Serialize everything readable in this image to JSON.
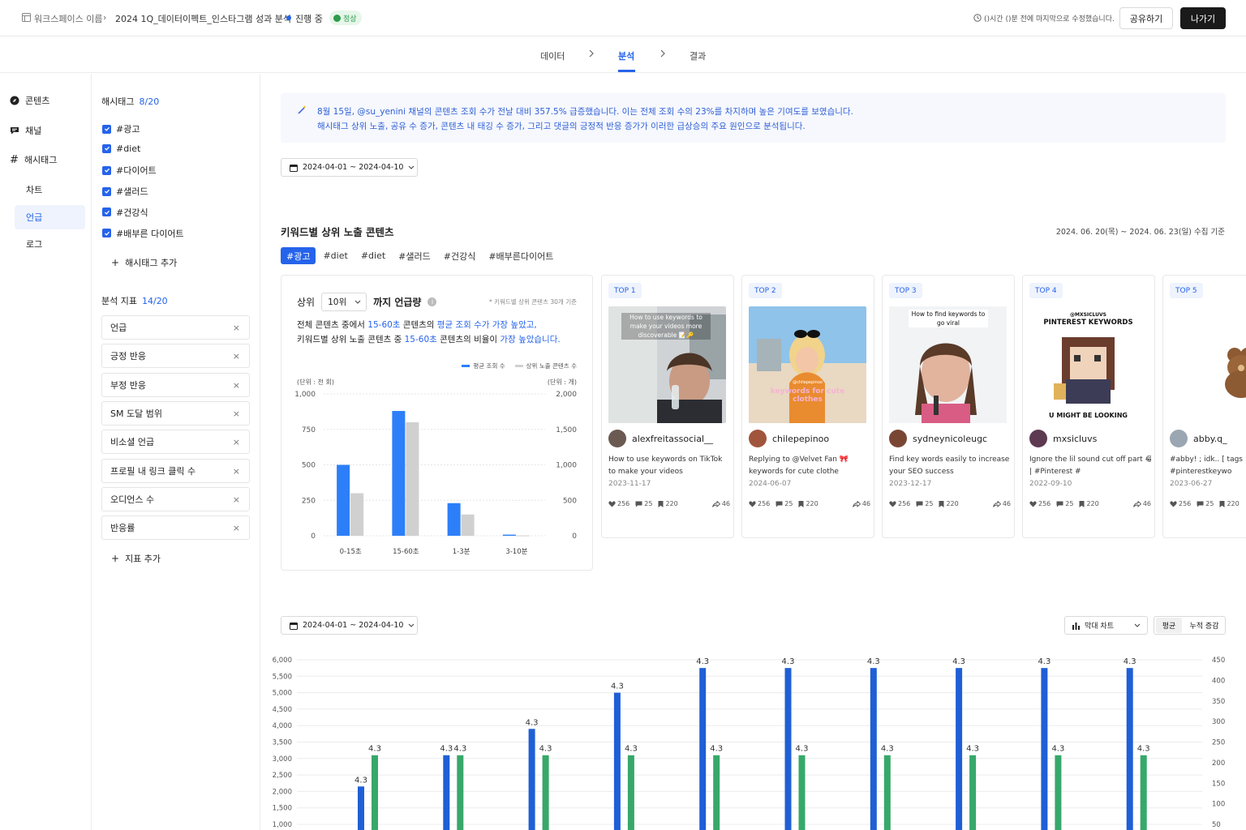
{
  "topbar": {
    "workspace": "워크스페이스 이름",
    "project": "2024 1Q_데이터이펙트_인스타그램 성과 분석",
    "status": "진행 중",
    "health": "정상",
    "modified": "()시간 ()분 전에 마지막으로 수정했습니다.",
    "share_label": "공유하기",
    "exit_label": "나가기"
  },
  "steps": [
    "데이터",
    "분석",
    "결과"
  ],
  "leftnav": {
    "items": [
      "콘텐츠",
      "채널",
      "해시태그"
    ],
    "subitems": [
      "차트",
      "언급",
      "로그"
    ]
  },
  "filter": {
    "hashtag_title": "해시태그",
    "hashtag_count": "8/20",
    "hashtags": [
      "#광고",
      "#diet",
      "#다이어트",
      "#샐러드",
      "#건강식",
      "#배부른 다이어트"
    ],
    "add_hashtag": "해시태그 추가",
    "metric_title": "분석 지표",
    "metric_count": "14/20",
    "metrics": [
      "언급",
      "긍정 반응",
      "부정 반응",
      "SM 도달 범위",
      "비소셜 언급",
      "프로필 내 링크 클릭 수",
      "오디언스 수",
      "반응률"
    ],
    "add_metric": "지표 추가"
  },
  "banner": {
    "line1": "8월 15일, @su_yenini 채널의 콘텐츠 조회 수가 전날 대비 357.5% 급증했습니다. 이는 전체 조회 수의 23%를 차지하며 높은 기여도를 보였습니다.",
    "line2": "해시태그 상위 노출, 공유 수 증가, 콘텐츠 내 태깅 수 증가, 그리고 댓글의 긍정적 반응 증가가 이러한 급상승의 주요 원인으로 분석됩니다."
  },
  "date_range": "2024-04-01 ~ 2024-04-10",
  "section": {
    "title": "키워드별 상위 노출 콘텐츠",
    "period": "2024. 06. 20(목) ~ 2024. 06. 23(일) 수집 기준",
    "keywords": [
      "#광고",
      "#diet",
      "#diet",
      "#샐러드",
      "#건강식",
      "#배부른다이어트"
    ]
  },
  "chartcard": {
    "prefix": "상위",
    "rank": "10위",
    "suffix": "까지 언급량",
    "note": "* 키워드별 상위 콘텐츠 30개 기준",
    "s1_a": "전체 콘텐츠 중에서 ",
    "s1_b": "15-60초",
    "s1_c": " 콘텐츠의 ",
    "s1_d": "평균 조회 수가 가장 높았고,",
    "s2_a": "키워드별 상위 노출 콘텐츠 중 ",
    "s2_b": "15-60초",
    "s2_c": " 콘텐츠의 비율이 ",
    "s2_d": "가장 높았습니다.",
    "legend": [
      "평균 조회 수",
      "상위 노출 콘텐츠 수"
    ],
    "unit_left": "(단위 : 천 회)",
    "unit_right": "(단위 : 개)"
  },
  "chart_data": [
    {
      "type": "bar",
      "categories": [
        "0-15초",
        "15-60초",
        "1-3분",
        "3-10분"
      ],
      "series": [
        {
          "name": "평균 조회 수",
          "values": [
            500,
            880,
            230,
            8
          ],
          "axis": "left"
        },
        {
          "name": "상위 노출 콘텐츠 수",
          "values": [
            600,
            1600,
            300,
            5
          ],
          "axis": "right"
        }
      ],
      "ylim_left": [
        0,
        1000
      ],
      "ylim_right": [
        0,
        2000
      ],
      "yticks_left": [
        "0",
        "250",
        "500",
        "750",
        "1,000"
      ],
      "yticks_right": [
        "0",
        "500",
        "1,000",
        "1,500",
        "2,000"
      ],
      "ylabel_left": "(단위 : 천 회)",
      "ylabel_right": "(단위 : 개)",
      "colors": [
        "#2d7ff9",
        "#d0d0d0"
      ],
      "legend": "top-right"
    },
    {
      "type": "bar",
      "series": [
        {
          "values": [
            2150,
            3100,
            3900,
            5000,
            5750,
            5750,
            5750,
            5750,
            5750,
            5750
          ],
          "labels": [
            "4.3",
            "4.3",
            "4.3",
            "4.3",
            "4.3",
            "4.3",
            "4.3",
            "4.3",
            "4.3",
            "4.3"
          ],
          "axis": "left"
        },
        {
          "values": [
            3100,
            3100,
            3100,
            3100,
            3100,
            3100,
            3100,
            3100,
            3100,
            3100
          ],
          "labels": [
            "4.3",
            "4.3",
            "4.3",
            "4.3",
            "4.3",
            "4.3",
            "4.3",
            "4.3",
            "4.3",
            "4.3"
          ],
          "axis": "left"
        }
      ],
      "yticks_left": [
        "1,000",
        "1,500",
        "2,000",
        "2,500",
        "3,000",
        "3,500",
        "4,000",
        "4,500",
        "5,000",
        "5,500",
        "6,000"
      ],
      "yticks_right": [
        "50",
        "100",
        "150",
        "200",
        "250",
        "300",
        "350",
        "400",
        "450"
      ],
      "ylim_left": [
        1000,
        6000
      ],
      "ylim_right": [
        50,
        450
      ],
      "colors": [
        "#1f5fd6",
        "#37a86a"
      ],
      "grid": true
    }
  ],
  "posts": [
    {
      "rank": "TOP 1",
      "user": "alexfreitassocial__",
      "cap1": "How to use keywords on TikTok",
      "cap2": "to make your videos",
      "date": "2023-11-17",
      "overlay": "How to use keywords to make your videos more discoverable 📝🔑",
      "likes": "256",
      "comments": "25",
      "saves": "220",
      "shares": "46"
    },
    {
      "rank": "TOP 2",
      "user": "chilepepinoo",
      "cap1": "Replying to @Velvet Fan 🎀",
      "cap2": "keywords for cute clothe",
      "date": "2024-06-07",
      "overlay": "keywords for cute clothes",
      "overlay_small": "@chilepepinoo",
      "likes": "256",
      "comments": "25",
      "saves": "220",
      "shares": "46"
    },
    {
      "rank": "TOP 3",
      "user": "sydneynicoleugc",
      "cap1": "Find key words easily to increase",
      "cap2": "your SEO success",
      "date": "2023-12-17",
      "overlay": "How to find keywords to go viral",
      "likes": "256",
      "comments": "25",
      "saves": "220",
      "shares": "46"
    },
    {
      "rank": "TOP 4",
      "user": "mxsicluvs",
      "cap1": "Ignore the lil sound cut off part 😂",
      "cap2": "| #Pinterest #",
      "date": "2022-09-10",
      "overlay_small": "@MXSICLUVS",
      "overlay": "PINTEREST KEYWORDS",
      "overlay_bottom": "U MIGHT BE LOOKING",
      "likes": "256",
      "comments": "25",
      "saves": "220",
      "shares": "46"
    },
    {
      "rank": "TOP 5",
      "user": "abby.q_",
      "cap1": "#abby! ; idk.. [ tags : #",
      "cap2": "#pinterestkeywo",
      "date": "2023-06-27",
      "likes": "256",
      "comments": "25",
      "saves": "220",
      "shares": ""
    }
  ],
  "bottom_controls": {
    "chart_type": "막대 차트",
    "mode_avg": "평균",
    "mode_cum": "누적 증감"
  },
  "colors": {
    "accent": "#2563eb",
    "dark": "#1a1a1a",
    "ok": "#2e9b4a"
  }
}
